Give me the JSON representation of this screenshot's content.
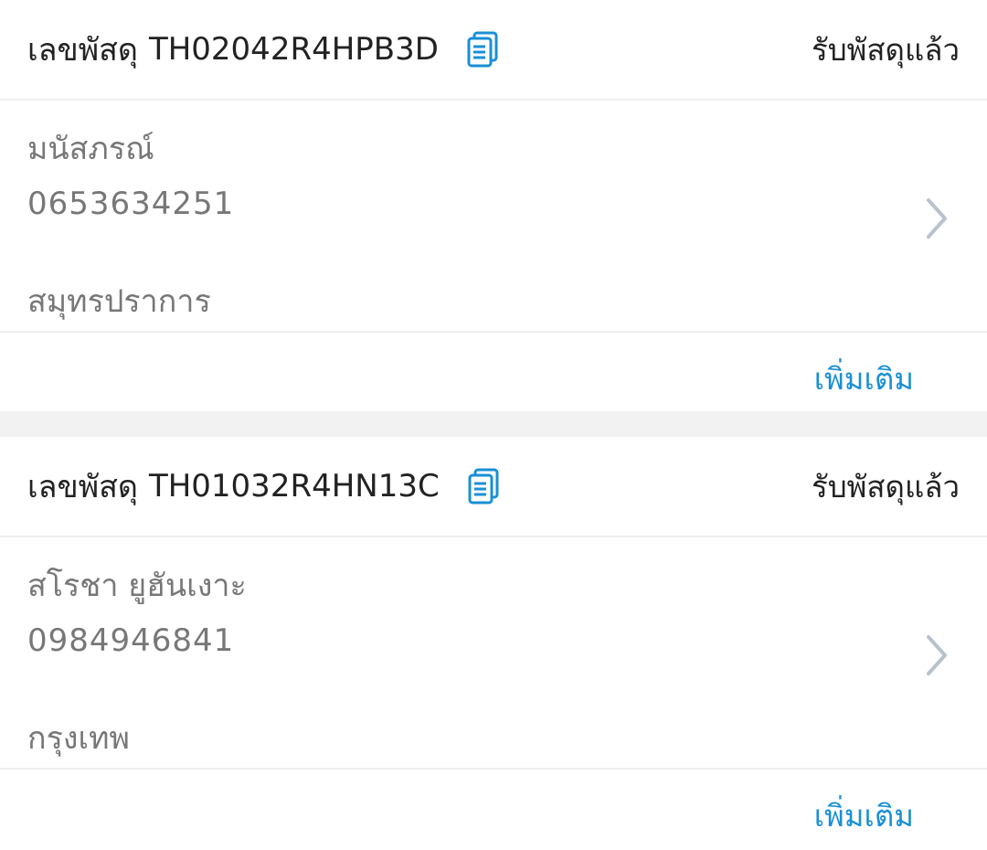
{
  "colors": {
    "accent": "#1a8fd6",
    "primary_text": "#222222",
    "secondary_text": "#777777",
    "divider": "#eeeeee",
    "separator": "#f2f2f2",
    "chevron": "#b8c2cc"
  },
  "parcels": [
    {
      "tracking_prefix": "เลขพัสดุ",
      "tracking_number": "TH02042R4HPB3D",
      "copy_icon": "copy-icon",
      "status": "รับพัสดุแล้ว",
      "recipient_name": "มนัสภรณ์",
      "recipient_phone": "0653634251",
      "recipient_province": "สมุทรปราการ",
      "more_label": "เพิ่มเติม"
    },
    {
      "tracking_prefix": "เลขพัสดุ",
      "tracking_number": "TH01032R4HN13C",
      "copy_icon": "copy-icon",
      "status": "รับพัสดุแล้ว",
      "recipient_name": "สโรชา ยูฮันเงาะ",
      "recipient_phone": "0984946841",
      "recipient_province": "กรุงเทพ",
      "more_label": "เพิ่มเติม"
    }
  ]
}
